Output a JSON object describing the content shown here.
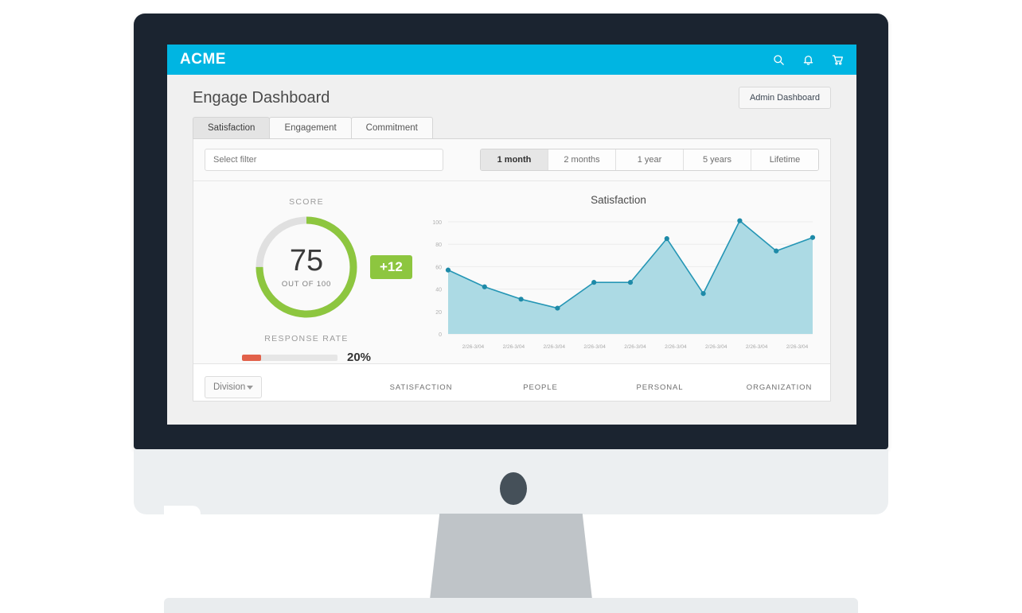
{
  "appbar": {
    "brand": "ACME",
    "icons": [
      {
        "name": "search-icon",
        "label": "Search"
      },
      {
        "name": "bell-icon",
        "label": "Notifications"
      },
      {
        "name": "cart-icon",
        "label": "Cart"
      }
    ],
    "accent_color": "#00b5e2"
  },
  "header": {
    "title": "Engage Dashboard",
    "admin_button": "Admin Dashboard"
  },
  "tabs": [
    {
      "label": "Satisfaction",
      "active": true
    },
    {
      "label": "Engagement",
      "active": false
    },
    {
      "label": "Commitment",
      "active": false
    }
  ],
  "filter": {
    "placeholder": "Select filter",
    "value": ""
  },
  "ranges": [
    {
      "label": "1 month",
      "active": true
    },
    {
      "label": "2 months",
      "active": false
    },
    {
      "label": "1 year",
      "active": false
    },
    {
      "label": "5 years",
      "active": false
    },
    {
      "label": "Lifetime",
      "active": false
    }
  ],
  "score": {
    "caption": "SCORE",
    "value": "75",
    "out_of": "OUT OF 100",
    "percent": 75,
    "delta": "+12",
    "arc_color": "#8dc63f",
    "track_color": "#e0e0e0"
  },
  "response_rate": {
    "caption": "RESPONSE RATE",
    "percent_label": "20%",
    "percent": 20,
    "fill_color": "#e2614a"
  },
  "bottom": {
    "division_label": "Division",
    "columns": [
      "SATISFACTION",
      "PEOPLE",
      "PERSONAL",
      "ORGANIZATION"
    ]
  },
  "chart_data": {
    "type": "area",
    "title": "Satisfaction",
    "xlabel": "",
    "ylabel": "",
    "ylim": [
      0,
      100
    ],
    "yticks": [
      0,
      20,
      40,
      60,
      80,
      100
    ],
    "grid": true,
    "legend": "none",
    "line_color": "#2596b5",
    "fill_color": "#a8d8e3",
    "point_color": "#1e8aa8",
    "categories": [
      "2/26-3/04",
      "2/26-3/04",
      "2/26-3/04",
      "2/26-3/04",
      "2/26-3/04",
      "2/26-3/04",
      "2/26-3/04",
      "2/26-3/04",
      "2/26-3/04",
      "2/26-3/04",
      "2/26-3/04"
    ],
    "tick_labels": [
      "2/26-3/04",
      "2/26-3/04",
      "2/26-3/04",
      "2/26-3/04",
      "2/26-3/04",
      "2/26-3/04",
      "2/26-3/04",
      "2/26-3/04",
      "2/26-3/04"
    ],
    "values": [
      57,
      42,
      31,
      23,
      46,
      46,
      85,
      36,
      101,
      74,
      86
    ]
  }
}
